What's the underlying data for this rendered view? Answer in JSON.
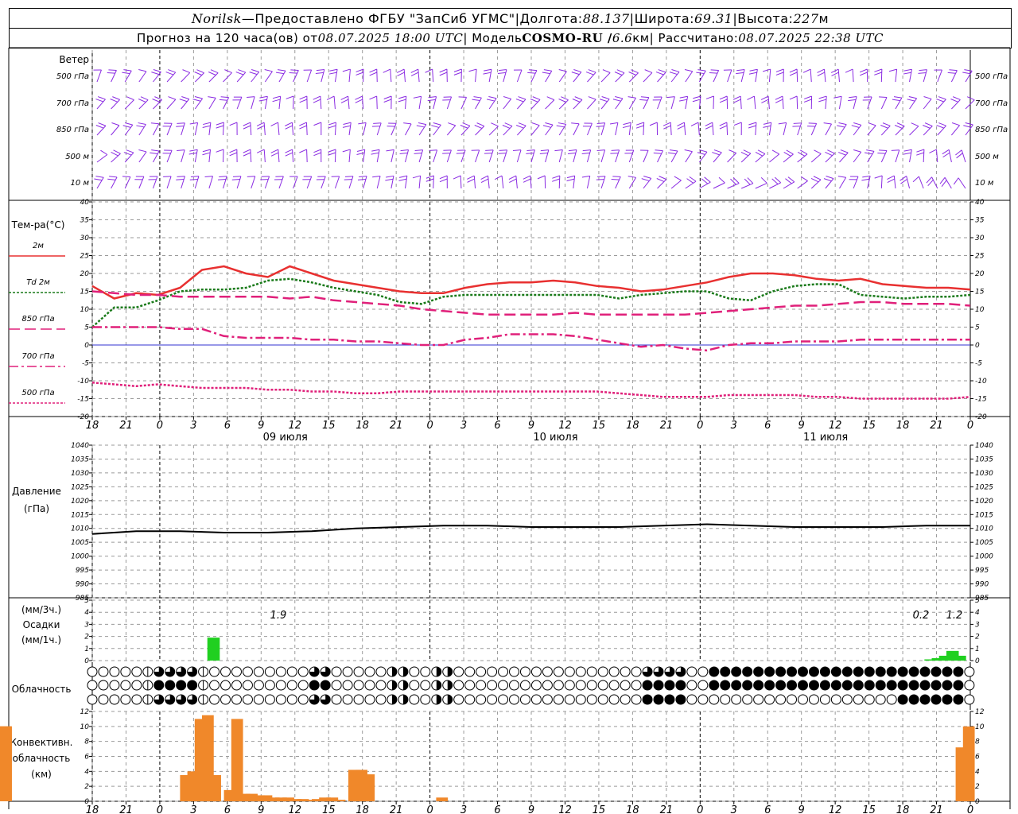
{
  "header": {
    "station": "Norilsk",
    "dash": " — ",
    "provider": "Предоставлено ФГБУ \"ЗапСиб УГМС\"",
    "sep": " | ",
    "lon_label": "Долгота: ",
    "lon_value": "88.137",
    "lat_label": "Широта: ",
    "lat_value": "69.31",
    "alt_label": "Высота: ",
    "alt_value": "227",
    "alt_unit": "м",
    "forecast_prefix": "Прогноз на 120 часа(ов) от ",
    "forecast_time": "08.07.2025 18:00 UTC",
    "model_label": " | Модель ",
    "model_name": "COSMO-RU / ",
    "model_res": "6.6",
    "model_unit": "км",
    "calc_label": " | Рассчитано: ",
    "calc_time": "08.07.2025 22:38 UTC"
  },
  "labels": {
    "wind": "Ветер",
    "temp": "Тем-ра(°C)",
    "pressure_1": "Давление",
    "pressure_2": "(гПа)",
    "precip_1": "(мм/3ч.)",
    "precip_2": "Осадки",
    "precip_3": "(мм/1ч.)",
    "cloud": "Облачность",
    "conv_1": "Конвективн.",
    "conv_2": "облачность",
    "conv_3": "(км)"
  },
  "wind_levels": [
    "500 гПа",
    "700 гПа",
    "850 гПа",
    "500 м",
    "10  м"
  ],
  "temp_legend": [
    {
      "label": "2м",
      "color": "#e83030",
      "dash": ""
    },
    {
      "label": "Td  2м",
      "color": "#1a7a1a",
      "dash": "3,2"
    },
    {
      "label": "850 гПа",
      "color": "#e0207a",
      "dash": "14,6"
    },
    {
      "label": "700 гПа",
      "color": "#e0207a",
      "dash": "12,4,3,4"
    },
    {
      "label": "500 гПа",
      "color": "#e0207a",
      "dash": "3,2"
    }
  ],
  "time_axis": {
    "ticks": [
      "18",
      "21",
      "0",
      "3",
      "6",
      "9",
      "12",
      "15",
      "18",
      "21",
      "0",
      "3",
      "6",
      "9",
      "12",
      "15",
      "18",
      "21",
      "0",
      "3",
      "6",
      "9",
      "12",
      "15",
      "18",
      "21",
      "0"
    ],
    "days": [
      "09 июля",
      "10 июля",
      "11 июля"
    ]
  },
  "precip_labels": [
    "1.9",
    "0.2",
    "1.2"
  ],
  "colors": {
    "wind": "#8a2be2",
    "precip": "#20d020",
    "conv": "#f0882a",
    "pressure": "#000000"
  },
  "chart_data": [
    {
      "type": "line",
      "title": "Тем-ра(°C)",
      "ylim": [
        -20,
        40
      ],
      "x_hours": [
        0,
        3,
        6,
        9,
        12,
        15,
        18,
        21,
        24,
        27,
        30,
        33,
        36,
        39,
        42,
        45,
        48,
        51,
        54,
        57,
        60,
        63,
        66,
        69,
        72,
        75,
        78,
        81,
        84,
        87,
        90,
        93,
        96,
        99,
        102,
        105,
        108,
        111,
        114,
        117,
        120
      ],
      "series": [
        {
          "name": "2м",
          "values": [
            16.5,
            13,
            14.5,
            14,
            16,
            21,
            22,
            20,
            19,
            22,
            20,
            18,
            17,
            16,
            15,
            14.5,
            14.5,
            16,
            17,
            17.5,
            17.5,
            18,
            17.5,
            16.5,
            16,
            15,
            15.5,
            16.5,
            17.5,
            19,
            20,
            20,
            19.5,
            18.5,
            18,
            18.5,
            17,
            16.5,
            16,
            16,
            15.5
          ]
        },
        {
          "name": "Td  2м",
          "values": [
            5,
            10.5,
            10.5,
            12.5,
            15,
            15.5,
            15.5,
            16,
            18,
            18.5,
            17.5,
            16,
            15,
            14,
            12,
            11.5,
            13.5,
            14,
            14,
            14,
            14,
            14,
            14,
            14,
            13,
            14,
            14.5,
            15,
            15,
            13,
            12.5,
            15,
            16.5,
            17,
            17,
            14,
            13.5,
            13,
            13.5,
            13.5,
            14
          ]
        },
        {
          "name": "850 гПа",
          "values": [
            15,
            14.5,
            14,
            14,
            13.5,
            13.5,
            13.5,
            13.5,
            13.5,
            13,
            13.5,
            12.5,
            12,
            11.5,
            11,
            10,
            9.5,
            9,
            8.5,
            8.5,
            8.5,
            8.5,
            9,
            8.5,
            8.5,
            8.5,
            8.5,
            8.5,
            9,
            9.5,
            10,
            10.5,
            11,
            11,
            11.5,
            12,
            12,
            11.5,
            11.5,
            11.5,
            11
          ]
        },
        {
          "name": "700 гПа",
          "values": [
            5,
            5,
            5,
            5,
            4.5,
            4.5,
            2.5,
            2,
            2,
            2,
            1.5,
            1.5,
            1,
            1,
            0.5,
            0,
            0,
            1.5,
            2,
            3,
            3,
            3,
            2.5,
            1.5,
            0.5,
            -0.5,
            0,
            -1,
            -1.5,
            0,
            0.5,
            0.5,
            1,
            1,
            1,
            1.5,
            1.5,
            1.5,
            1.5,
            1.5,
            1.5
          ]
        },
        {
          "name": "500 гПа",
          "values": [
            -10.5,
            -11,
            -11.5,
            -11,
            -11.5,
            -12,
            -12,
            -12,
            -12.5,
            -12.5,
            -13,
            -13,
            -13.5,
            -13.5,
            -13,
            -13,
            -13,
            -13,
            -13,
            -13,
            -13,
            -13,
            -13,
            -13,
            -13.5,
            -14,
            -14.5,
            -14.5,
            -14.5,
            -14,
            -14,
            -14,
            -14,
            -14.5,
            -14.5,
            -15,
            -15,
            -15,
            -15,
            -15,
            -14.5
          ]
        }
      ]
    },
    {
      "type": "line",
      "title": "Давление (гПа)",
      "ylim": [
        985,
        1040
      ],
      "x_hours": [
        0,
        6,
        12,
        18,
        24,
        30,
        36,
        42,
        48,
        54,
        60,
        66,
        72,
        78,
        84,
        90,
        96,
        102,
        108,
        114,
        120
      ],
      "series": [
        {
          "name": "",
          "values": [
            1008,
            1009,
            1009,
            1008.5,
            1008.5,
            1009,
            1010,
            1010.5,
            1011,
            1011,
            1010.5,
            1010.5,
            1010.5,
            1011,
            1011.5,
            1011,
            1010.5,
            1010.5,
            1010.5,
            1011,
            1011
          ]
        }
      ]
    },
    {
      "type": "bar",
      "title": "Осадки",
      "ylim": [
        0,
        5
      ],
      "x_hours": [
        12,
        13,
        14,
        15,
        16,
        17,
        18,
        19,
        20,
        21,
        22,
        23,
        24,
        25,
        26,
        27,
        28,
        29,
        30,
        31,
        32,
        33,
        34,
        35,
        36,
        37,
        38,
        39,
        40,
        41,
        42,
        43,
        44,
        45,
        46,
        47,
        48,
        49,
        50,
        51,
        52,
        53,
        54,
        55,
        56,
        57,
        58,
        59,
        60,
        61,
        62,
        63,
        64,
        65,
        66,
        67,
        68,
        69,
        70,
        71,
        72,
        73,
        74,
        75,
        76,
        77,
        78,
        79,
        80,
        81,
        82,
        83,
        84,
        85,
        86,
        87,
        88,
        89,
        90,
        91,
        92,
        93,
        94,
        95,
        96,
        97,
        98,
        99,
        100,
        101,
        102,
        103,
        104,
        105,
        106,
        107,
        108,
        109,
        110,
        111,
        112,
        113,
        114,
        115,
        116,
        117,
        118,
        119
      ],
      "values_note_hours": [
        16.5,
        114.5,
        115.5,
        116.5,
        117.5,
        118.5
      ],
      "values": [
        1.9,
        0.1,
        0.2,
        0.4,
        0.8,
        0.4
      ]
    },
    {
      "type": "bar",
      "title": "Конвективн. облачность (км)",
      "ylim": [
        0,
        12
      ],
      "x_hours": [
        12,
        13,
        14,
        15,
        16,
        17,
        18,
        19,
        20,
        21,
        22,
        23,
        24,
        25,
        26,
        27,
        28,
        29,
        30,
        31,
        32,
        33,
        34,
        35,
        36,
        37,
        38,
        39,
        40,
        41,
        42,
        43,
        44,
        45,
        46,
        47,
        48,
        49,
        50,
        51,
        52,
        53,
        54,
        55,
        56,
        57,
        58,
        59,
        60,
        61,
        62,
        63,
        64,
        65,
        66,
        67,
        68,
        69,
        70,
        71,
        72,
        73,
        74,
        75,
        76,
        77,
        78,
        79,
        80,
        81,
        82,
        83,
        84,
        85,
        86,
        87,
        88,
        89,
        90,
        91,
        92,
        93,
        94,
        95,
        96,
        97,
        98,
        99,
        100,
        101,
        102,
        103,
        104,
        105,
        106,
        107,
        108,
        109,
        110,
        111,
        112,
        113,
        114,
        115,
        116,
        117,
        118,
        119
      ],
      "values": [
        3.5,
        4.0,
        11.0,
        11.5,
        3.5,
        0,
        1.5,
        11.0,
        1.0,
        1.0,
        0.8,
        0.8,
        0.5,
        0.5,
        0.5,
        0.3,
        0.3,
        0.2,
        0.3,
        0.5,
        0.5,
        0.2,
        0,
        4.2,
        4.2,
        3.6,
        0,
        0,
        0,
        0,
        0,
        0,
        0,
        0,
        0,
        0.5,
        0,
        0,
        0,
        0,
        0,
        0,
        0,
        0,
        0,
        0,
        0,
        0,
        0,
        0,
        0,
        0,
        0,
        0,
        0,
        0,
        0,
        0,
        0,
        0,
        0,
        0,
        0,
        0,
        0,
        0,
        0,
        0,
        0,
        0,
        0,
        0,
        0,
        0,
        0,
        0,
        0,
        0,
        0,
        0,
        0,
        0,
        0,
        0,
        0,
        0,
        0,
        0,
        0,
        0,
        0,
        0,
        0,
        0,
        0,
        0,
        0,
        0,
        0,
        0,
        0,
        0,
        0,
        0,
        0,
        0,
        7.2,
        10.0,
        10.0,
        10.0,
        10.0,
        10.0
      ]
    }
  ]
}
